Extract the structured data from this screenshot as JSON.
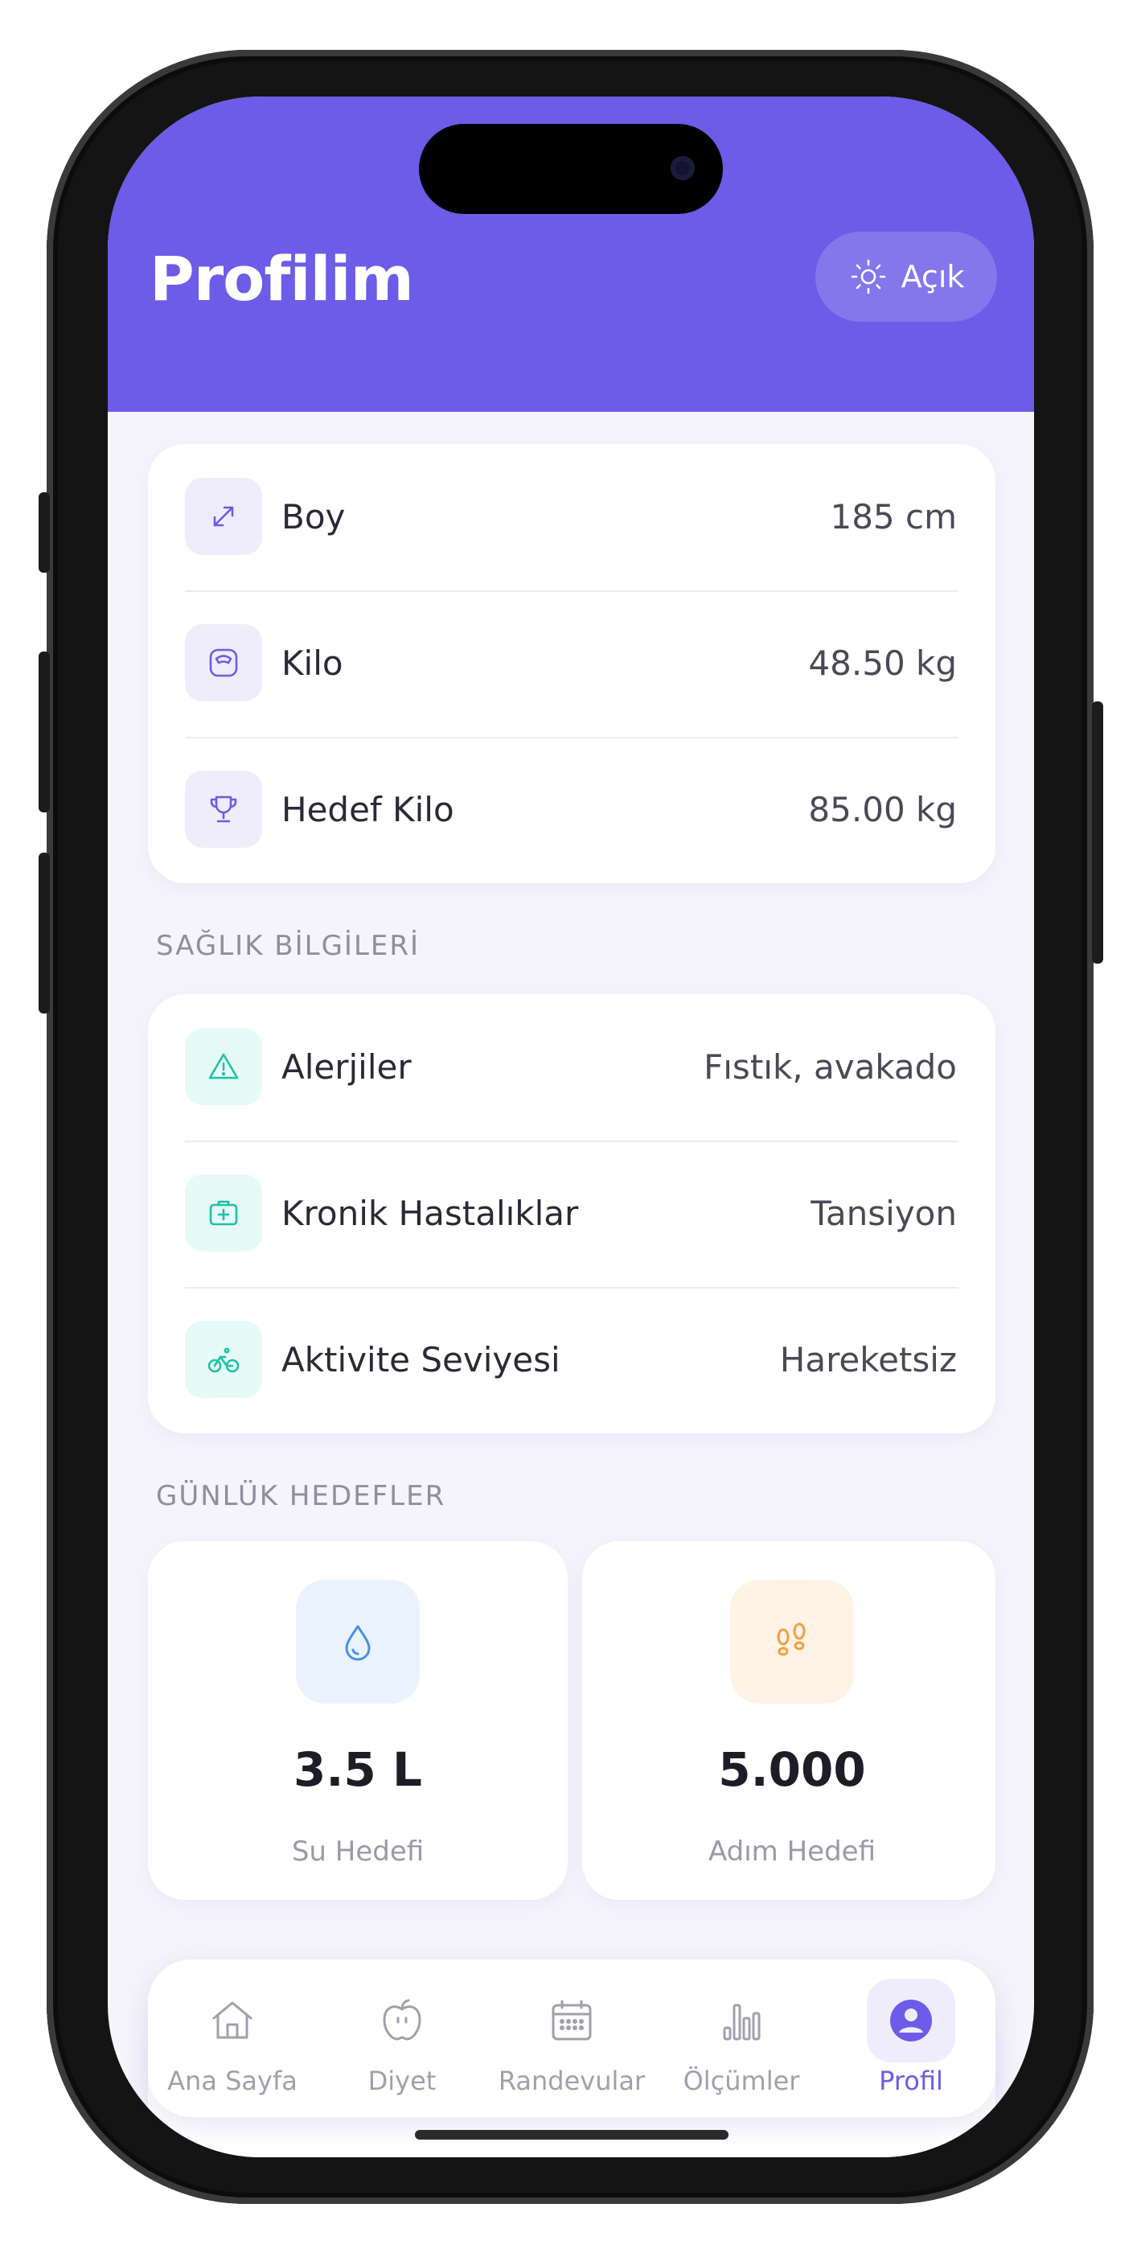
{
  "header": {
    "title": "Profilim",
    "theme_toggle": {
      "label": "Açık",
      "icon": "sun-icon"
    }
  },
  "body_metrics": [
    {
      "icon": "resize-arrows-icon",
      "label": "Boy",
      "value": "185 cm"
    },
    {
      "icon": "scale-icon",
      "label": "Kilo",
      "value": "48.50 kg"
    },
    {
      "icon": "trophy-icon",
      "label": "Hedef Kilo",
      "value": "85.00 kg"
    }
  ],
  "health": {
    "title": "SAĞLIK BİLGİLERİ",
    "items": [
      {
        "icon": "warning-triangle-icon",
        "label": "Alerjiler",
        "value": "Fıstık, avakado"
      },
      {
        "icon": "medical-kit-icon",
        "label": "Kronik Hastalıklar",
        "value": "Tansiyon"
      },
      {
        "icon": "bicycle-icon",
        "label": "Aktivite Seviyesi",
        "value": "Hareketsiz"
      }
    ]
  },
  "daily_goals": {
    "title": "GÜNLÜK HEDEFLER",
    "items": [
      {
        "icon": "water-drop-icon",
        "value": "3.5 L",
        "label": "Su Hedefi",
        "color": "#4a90e2"
      },
      {
        "icon": "footprints-icon",
        "value": "5.000",
        "label": "Adım Hedefi",
        "color": "#f0a040"
      }
    ]
  },
  "nav": {
    "items": [
      {
        "icon": "home-icon",
        "label": "Ana Sayfa",
        "active": false
      },
      {
        "icon": "apple-icon",
        "label": "Diyet",
        "active": false
      },
      {
        "icon": "calendar-icon",
        "label": "Randevular",
        "active": false
      },
      {
        "icon": "bar-chart-icon",
        "label": "Ölçümler",
        "active": false
      },
      {
        "icon": "profile-icon",
        "label": "Profil",
        "active": true
      }
    ]
  },
  "colors": {
    "primary": "#6c5ce7",
    "teal": "#20c0a8",
    "background": "#f5f4fb"
  }
}
